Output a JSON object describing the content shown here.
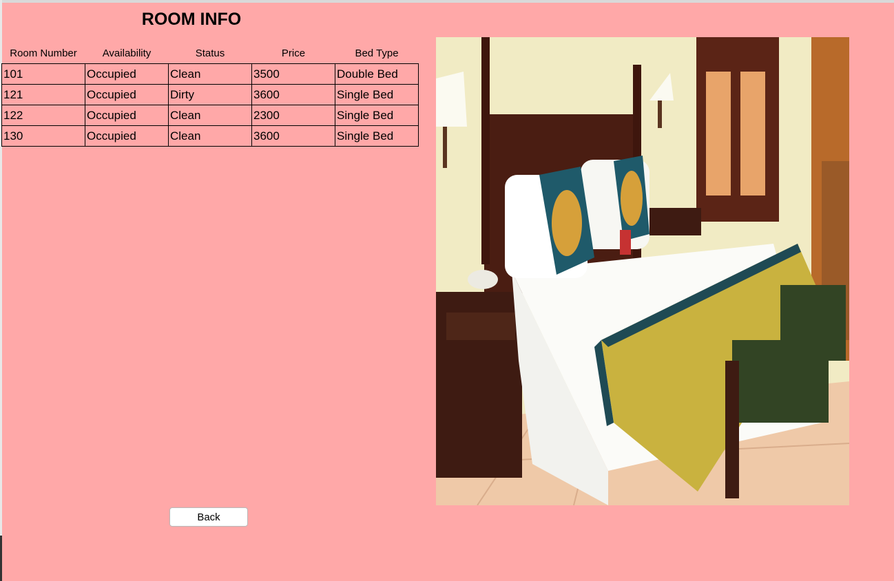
{
  "page": {
    "title": "ROOM INFO"
  },
  "table": {
    "columns": [
      "Room Number",
      "Availability",
      "Status",
      "Price",
      "Bed Type"
    ],
    "rows": [
      [
        "101",
        "Occupied",
        "Clean",
        "3500",
        "Double Bed"
      ],
      [
        "121",
        "Occupied",
        "Dirty",
        "3600",
        "Single Bed"
      ],
      [
        "122",
        "Occupied",
        "Clean",
        "2300",
        "Single Bed"
      ],
      [
        "130",
        "Occupied",
        "Clean",
        "3600",
        "Single Bed"
      ]
    ]
  },
  "actions": {
    "back_label": "Back"
  },
  "colors": {
    "background": "#ffa8a8",
    "button": "#ffffff",
    "border": "#000000"
  }
}
